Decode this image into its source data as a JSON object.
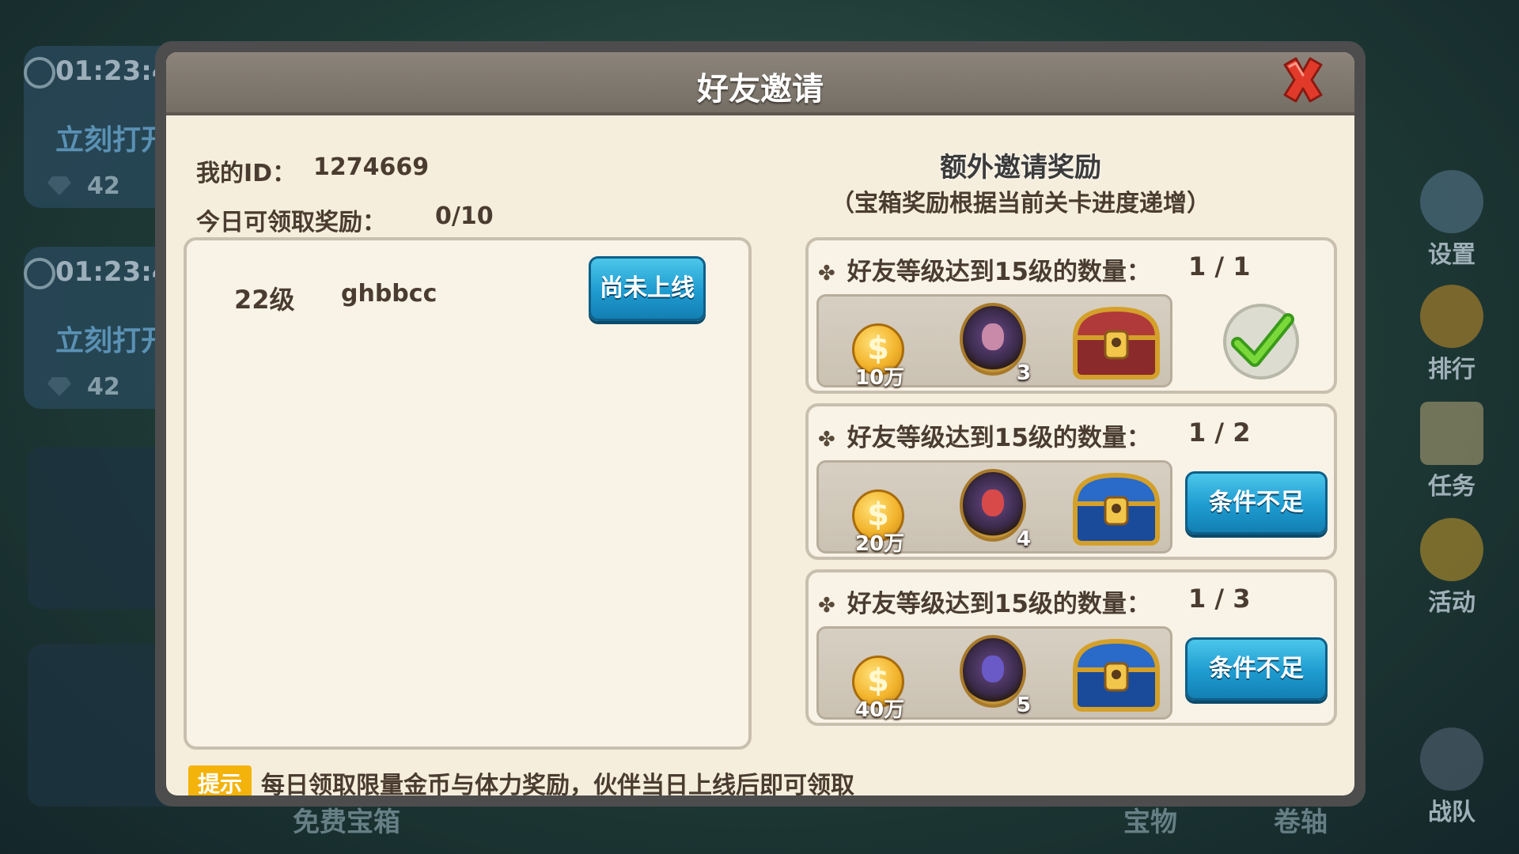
{
  "background": {
    "timer_cards": [
      {
        "timer": "01:23:4",
        "open_label": "立刻打开",
        "gems": "42"
      },
      {
        "timer": "01:23:4",
        "open_label": "立刻打开",
        "gems": "42"
      }
    ],
    "side_menu": [
      {
        "label": "设置",
        "icon": "gear-icon"
      },
      {
        "label": "排行",
        "icon": "trophy-icon"
      },
      {
        "label": "任务",
        "icon": "scroll-icon"
      },
      {
        "label": "活动",
        "icon": "bell-icon"
      },
      {
        "label": "战队",
        "icon": "helmet-icon"
      }
    ],
    "bottom_tabs": [
      "免费宝箱",
      "宝物",
      "卷轴"
    ]
  },
  "dialog": {
    "title": "好友邀请",
    "my_id_label": "我的ID：",
    "my_id_value": "1274669",
    "today_label": "今日可领取奖励：",
    "today_value": "0/10",
    "friends": [
      {
        "level": "22级",
        "name": "ghbbcc",
        "status_button": "尚未上线"
      }
    ],
    "extra_title": "额外邀请奖励",
    "extra_subtitle": "（宝箱奖励根据当前关卡进度递增）",
    "rewards": [
      {
        "condition": "好友等级达到15级的数量：",
        "progress": "1 / 1",
        "coin": "10万",
        "hero_count": "3",
        "chest": "red",
        "state": "claimed",
        "button": ""
      },
      {
        "condition": "好友等级达到15级的数量：",
        "progress": "1 / 2",
        "coin": "20万",
        "hero_count": "4",
        "chest": "blue",
        "state": "locked",
        "button": "条件不足"
      },
      {
        "condition": "好友等级达到15级的数量：",
        "progress": "1 / 3",
        "coin": "40万",
        "hero_count": "5",
        "chest": "blue",
        "state": "locked",
        "button": "条件不足"
      }
    ],
    "tip_badge": "提示",
    "tip_text": "每日领取限量金币与体力奖励，伙伴当日上线后即可领取"
  },
  "colors": {
    "panel_bg": "#f6eedd",
    "title_bar": "#7f786e",
    "button_blue": "#1e9bd0",
    "tip_yellow": "#f4b30a",
    "close_red": "#e23a2a"
  }
}
